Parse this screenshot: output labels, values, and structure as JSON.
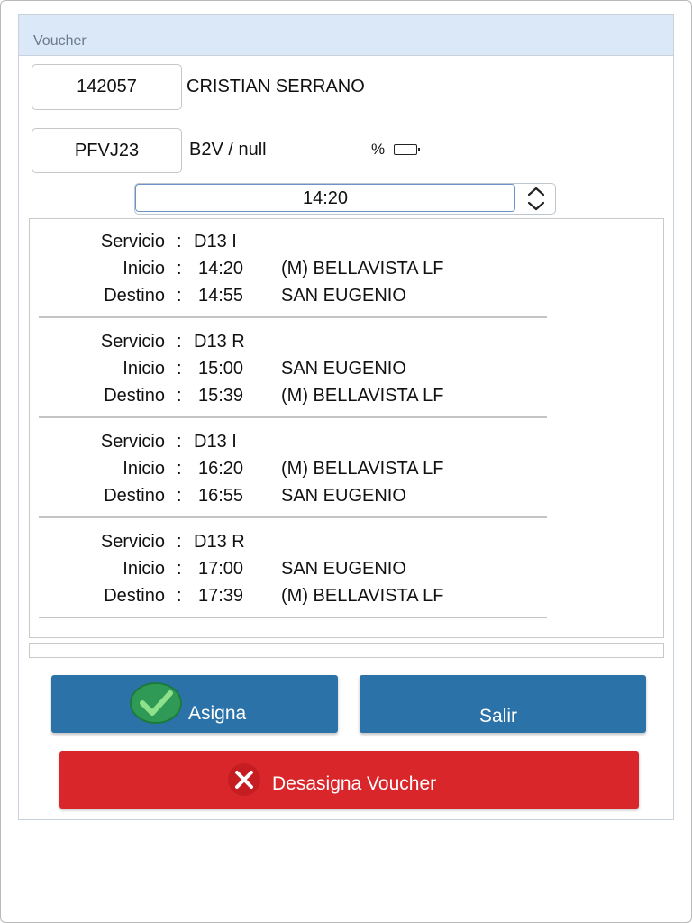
{
  "panel": {
    "title": "Voucher"
  },
  "driver": {
    "id": "142057",
    "name": "CRISTIAN SERRANO"
  },
  "vehicle": {
    "plate": "PFVJ23",
    "type": "B2V / null",
    "battery_label": "%",
    "battery_icon": "battery-icon"
  },
  "time_select": {
    "value": "14:20"
  },
  "colors": {
    "header_bg": "#dae8f7",
    "primary": "#2b72a8",
    "danger": "#d9262b",
    "check": "#4caf50"
  },
  "labels": {
    "servicio": "Servicio",
    "inicio": "Inicio",
    "destino": "Destino",
    "colon": ":"
  },
  "trips": [
    {
      "servicio": "D13 I",
      "inicio_time": "14:20",
      "inicio_place": "(M) BELLAVISTA LF",
      "destino_time": "14:55",
      "destino_place": "SAN EUGENIO"
    },
    {
      "servicio": "D13 R",
      "inicio_time": "15:00",
      "inicio_place": "SAN EUGENIO",
      "destino_time": "15:39",
      "destino_place": "(M) BELLAVISTA LF"
    },
    {
      "servicio": "D13 I",
      "inicio_time": "16:20",
      "inicio_place": "(M) BELLAVISTA LF",
      "destino_time": "16:55",
      "destino_place": "SAN EUGENIO"
    },
    {
      "servicio": "D13 R",
      "inicio_time": "17:00",
      "inicio_place": "SAN EUGENIO",
      "destino_time": "17:39",
      "destino_place": "(M) BELLAVISTA LF"
    }
  ],
  "buttons": {
    "assign": "Asigna",
    "exit": "Salir",
    "unassign": "Desasigna Voucher"
  }
}
